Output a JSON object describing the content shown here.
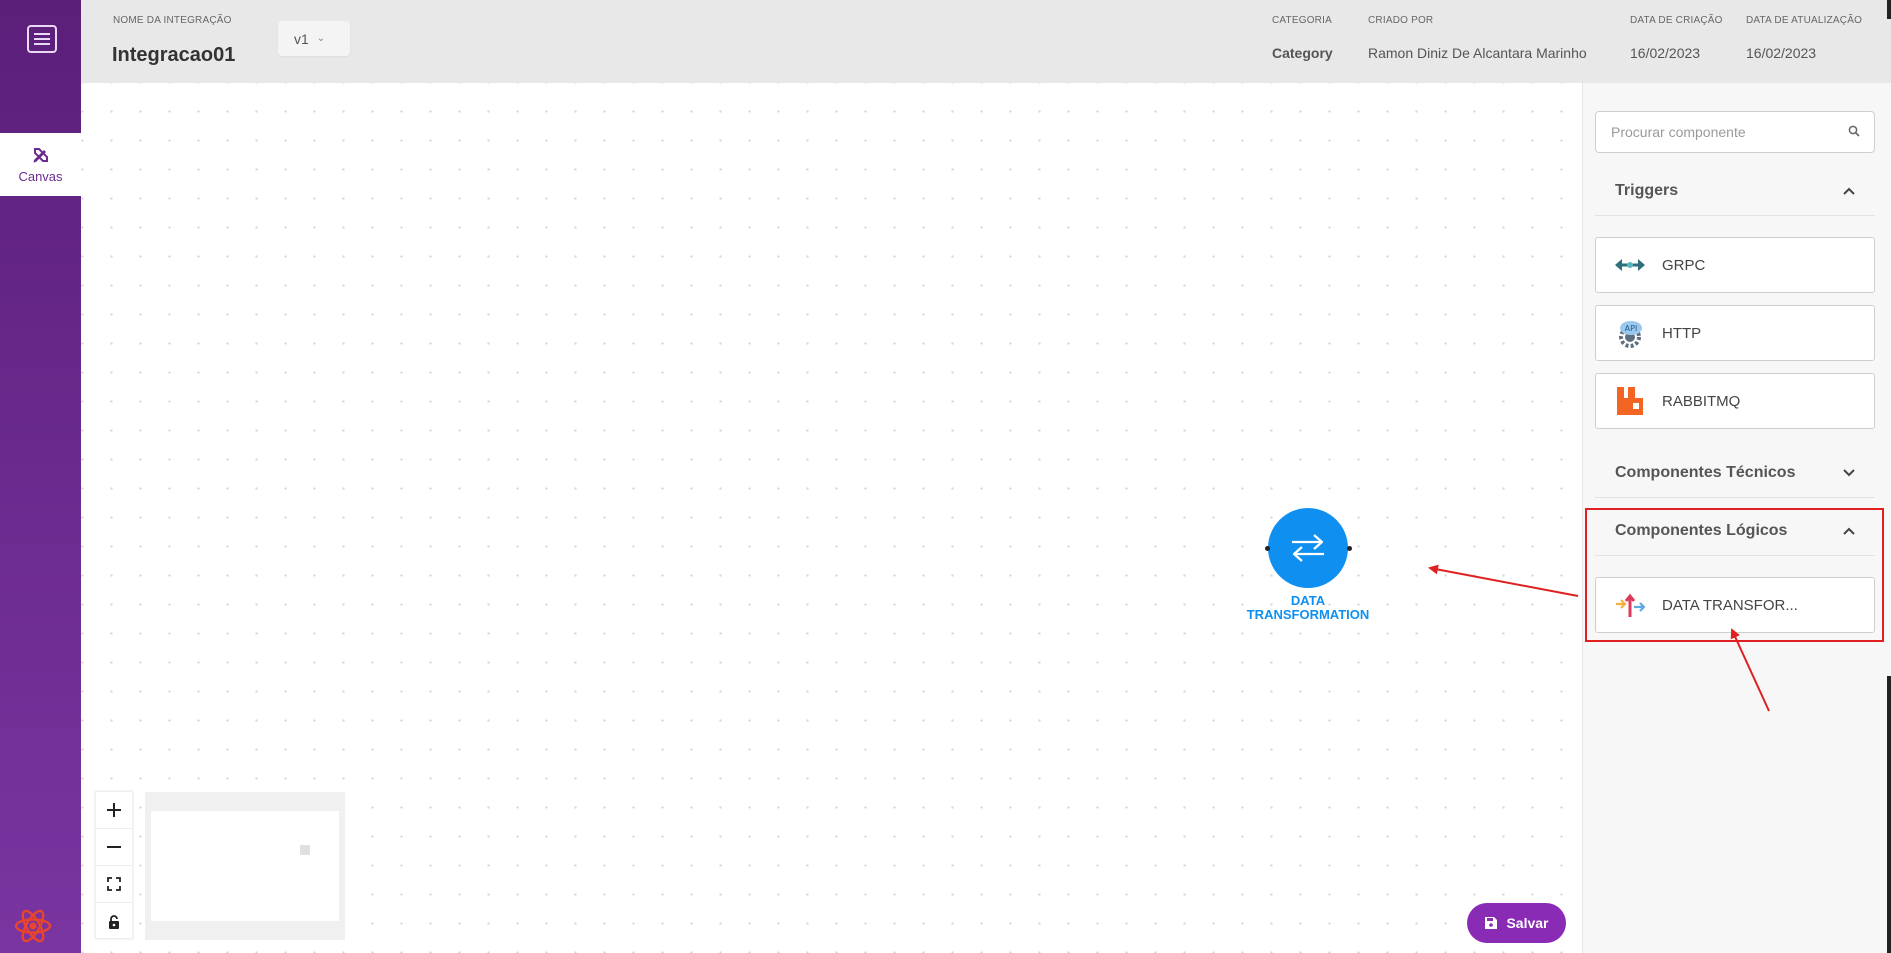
{
  "sidebar": {
    "menu_icon": "hamburger-menu-icon",
    "items": [
      {
        "label": "Canvas",
        "icon": "pencil-ruler-icon",
        "active": true
      }
    ],
    "footer_logo": "react-atom-icon"
  },
  "header": {
    "integration_name_label": "NOME DA INTEGRAÇÃO",
    "integration_name": "Integracao01",
    "version": "v1",
    "category_label": "CATEGORIA",
    "category": "Category",
    "created_by_label": "CRIADO POR",
    "created_by": "Ramon Diniz De Alcantara Marinho",
    "created_date_label": "DATA DE CRIAÇÃO",
    "created_date": "16/02/2023",
    "updated_date_label": "DATA DE ATUALIZAÇÃO",
    "updated_date": "16/02/2023"
  },
  "canvas": {
    "node": {
      "label_line1": "DATA",
      "label_line2": "TRANSFORMATION",
      "icon": "swap-arrows-icon",
      "color": "#0f8ff0"
    },
    "controls": [
      "zoom-in",
      "zoom-out",
      "fit-view",
      "lock"
    ],
    "save_label": "Salvar"
  },
  "panel": {
    "search_placeholder": "Procurar componente",
    "sections": [
      {
        "title": "Triggers",
        "expanded": true,
        "items": [
          {
            "name": "GRPC",
            "icon": "grpc-icon"
          },
          {
            "name": "HTTP",
            "icon": "api-gear-icon"
          },
          {
            "name": "RABBITMQ",
            "icon": "rabbitmq-icon"
          }
        ]
      },
      {
        "title": "Componentes Técnicos",
        "expanded": false,
        "items": []
      },
      {
        "title": "Componentes Lógicos",
        "expanded": true,
        "items": [
          {
            "name": "DATA TRANSFOR...",
            "icon": "data-transform-icon"
          }
        ]
      }
    ]
  },
  "colors": {
    "brand_purple": "#6b2b8f",
    "node_blue": "#0f8ff0",
    "annotation_red": "#e02020",
    "save_button": "#8a2bb6"
  }
}
